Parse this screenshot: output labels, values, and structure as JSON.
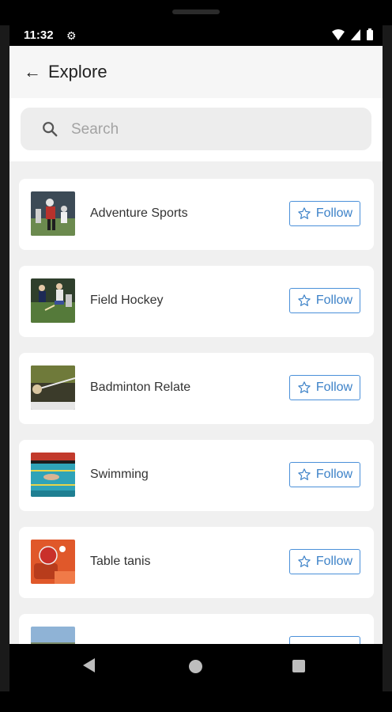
{
  "status_bar": {
    "time": "11:32"
  },
  "header": {
    "title": "Explore"
  },
  "search": {
    "placeholder": "Search"
  },
  "items": [
    {
      "name": "Adventure Sports",
      "follow_label": "Follow"
    },
    {
      "name": "Field Hockey",
      "follow_label": "Follow"
    },
    {
      "name": "Badminton Relate",
      "follow_label": "Follow"
    },
    {
      "name": "Swimming",
      "follow_label": "Follow"
    },
    {
      "name": "Table tanis",
      "follow_label": "Follow"
    },
    {
      "name": "",
      "follow_label": ""
    }
  ],
  "colors": {
    "accent": "#3d82c8",
    "background": "#f0f0f0"
  },
  "icons": {
    "back": "arrow-left-icon",
    "search": "search-icon",
    "follow": "star-outline-icon"
  }
}
